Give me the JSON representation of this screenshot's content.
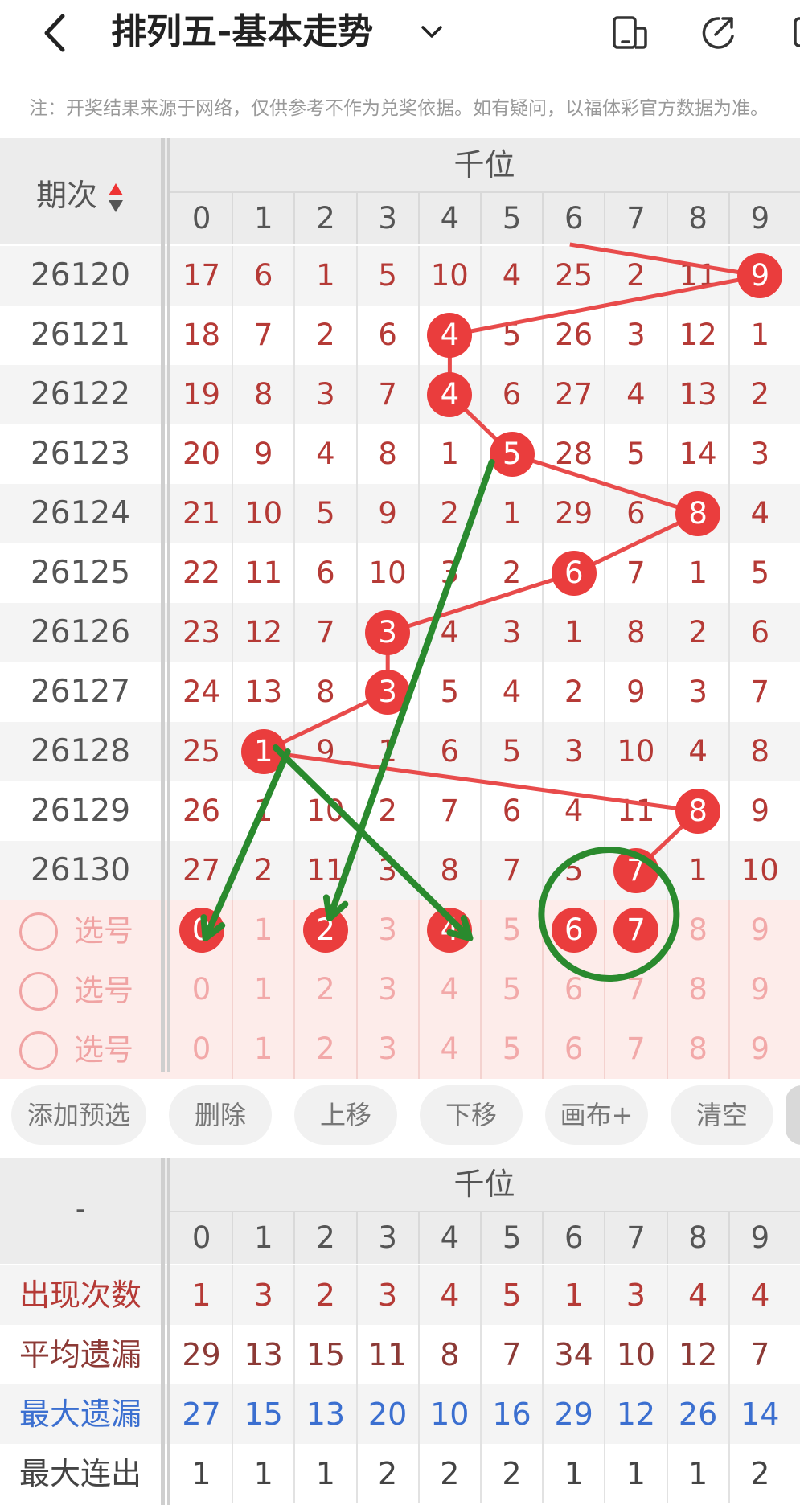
{
  "header": {
    "title": "排列五-基本走势",
    "back_icon": "chevron-left-icon",
    "dropdown_icon": "chevron-down-icon",
    "action_icons": [
      "device-icon",
      "share-icon",
      "more-icon"
    ]
  },
  "notice": "注：开奖结果来源于网络，仅供参考不作为兑奖依据。如有疑问，以福体彩官方数据为准。",
  "trend": {
    "issue_header": "期次",
    "group_title": "千位",
    "digits": [
      "0",
      "1",
      "2",
      "3",
      "4",
      "5",
      "6",
      "7",
      "8",
      "9"
    ],
    "rows": [
      {
        "issue": "26120",
        "cells": [
          "17",
          "6",
          "1",
          "5",
          "10",
          "4",
          "25",
          "2",
          "11",
          "9"
        ],
        "hit": 9
      },
      {
        "issue": "26121",
        "cells": [
          "18",
          "7",
          "2",
          "6",
          "4",
          "5",
          "26",
          "3",
          "12",
          "1"
        ],
        "hit": 4
      },
      {
        "issue": "26122",
        "cells": [
          "19",
          "8",
          "3",
          "7",
          "4",
          "6",
          "27",
          "4",
          "13",
          "2"
        ],
        "hit": 4
      },
      {
        "issue": "26123",
        "cells": [
          "20",
          "9",
          "4",
          "8",
          "1",
          "5",
          "28",
          "5",
          "14",
          "3"
        ],
        "hit": 5
      },
      {
        "issue": "26124",
        "cells": [
          "21",
          "10",
          "5",
          "9",
          "2",
          "1",
          "29",
          "6",
          "8",
          "4"
        ],
        "hit": 8
      },
      {
        "issue": "26125",
        "cells": [
          "22",
          "11",
          "6",
          "10",
          "3",
          "2",
          "6",
          "7",
          "1",
          "5"
        ],
        "hit": 6
      },
      {
        "issue": "26126",
        "cells": [
          "23",
          "12",
          "7",
          "3",
          "4",
          "3",
          "1",
          "8",
          "2",
          "6"
        ],
        "hit": 3
      },
      {
        "issue": "26127",
        "cells": [
          "24",
          "13",
          "8",
          "3",
          "5",
          "4",
          "2",
          "9",
          "3",
          "7"
        ],
        "hit": 3
      },
      {
        "issue": "26128",
        "cells": [
          "25",
          "1",
          "9",
          "1",
          "6",
          "5",
          "3",
          "10",
          "4",
          "8"
        ],
        "hit": 1
      },
      {
        "issue": "26129",
        "cells": [
          "26",
          "1",
          "10",
          "2",
          "7",
          "6",
          "4",
          "11",
          "8",
          "9"
        ],
        "hit": 8
      },
      {
        "issue": "26130",
        "cells": [
          "27",
          "2",
          "11",
          "3",
          "8",
          "7",
          "5",
          "7",
          "1",
          "10"
        ],
        "hit": 7
      }
    ],
    "pick_rows": [
      {
        "label": "选号",
        "selected": [
          0,
          2,
          4,
          6,
          7
        ]
      },
      {
        "label": "选号",
        "selected": []
      },
      {
        "label": "选号",
        "selected": []
      }
    ]
  },
  "toolbar": {
    "buttons": [
      "添加预选",
      "删除",
      "上移",
      "下移",
      "画布+",
      "清空"
    ]
  },
  "stats": {
    "corner_label": "-",
    "group_title": "千位",
    "rows": [
      {
        "label": "出现次数",
        "color": "#b53a36",
        "values": [
          "1",
          "3",
          "2",
          "3",
          "4",
          "5",
          "1",
          "3",
          "4",
          "4"
        ]
      },
      {
        "label": "平均遗漏",
        "color": "#8c3a36",
        "values": [
          "29",
          "13",
          "15",
          "11",
          "8",
          "7",
          "34",
          "10",
          "12",
          "7"
        ]
      },
      {
        "label": "最大遗漏",
        "color": "#3b6fd0",
        "values": [
          "27",
          "15",
          "13",
          "20",
          "10",
          "16",
          "29",
          "12",
          "26",
          "14"
        ]
      },
      {
        "label": "最大连出",
        "color": "#444444",
        "values": [
          "1",
          "1",
          "1",
          "2",
          "2",
          "2",
          "1",
          "1",
          "1",
          "2"
        ]
      }
    ]
  },
  "colors": {
    "ball": "#ea3d3d",
    "trend_line": "#e84b4b",
    "annotation": "#2a8a2e",
    "pick_band": "#fdecea"
  }
}
